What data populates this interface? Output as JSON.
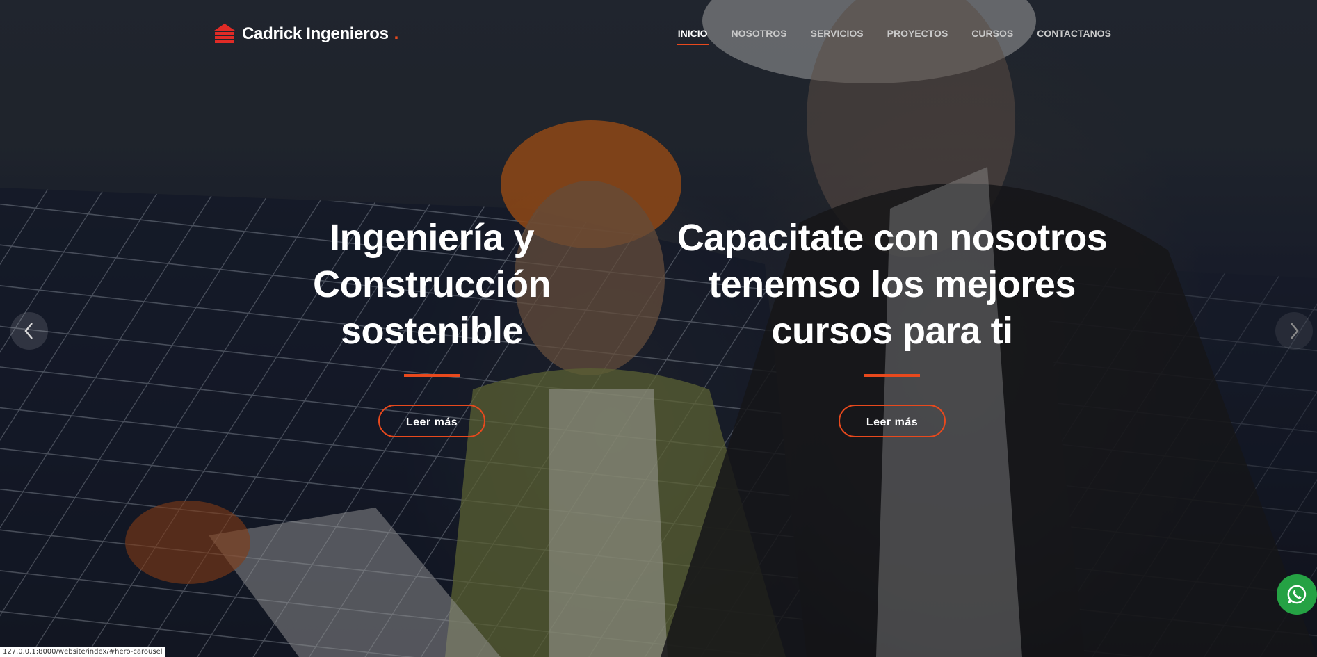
{
  "brand": {
    "name": "Cadrick Ingenieros",
    "dot": ".",
    "accent": "#e8491d"
  },
  "nav": {
    "items": [
      {
        "label": "INICIO",
        "active": true
      },
      {
        "label": "NOSOTROS",
        "active": false
      },
      {
        "label": "SERVICIOS",
        "active": false
      },
      {
        "label": "PROYECTOS",
        "active": false
      },
      {
        "label": "CURSOS",
        "active": false
      },
      {
        "label": "CONTACTANOS",
        "active": false
      }
    ]
  },
  "slides": [
    {
      "title_line1": "Ingeniería y Construcción",
      "title_line2": "sostenible",
      "button": "Leer más"
    },
    {
      "title_line1": "Capacitate con nosotros",
      "title_line2": "tenemso los mejores",
      "title_line3": "cursos para ti",
      "button": "Leer más"
    }
  ],
  "controls": {
    "prev_icon": "chevron-left-icon",
    "next_icon": "chevron-right-icon"
  },
  "whatsapp": {
    "icon": "whatsapp-icon",
    "color": "#25a244"
  },
  "status_bar": {
    "url": "127.0.0.1:8000/website/index/#hero-carousel"
  }
}
